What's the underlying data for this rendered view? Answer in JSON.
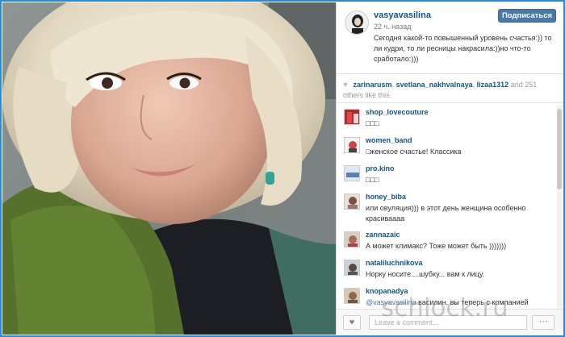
{
  "post": {
    "username": "vasyavasilina",
    "time": "22 ч. назад",
    "follow_label": "Подписаться",
    "caption": "Сегодня какой-то повышенный уровень счастья:)) то ли кудри, то ли ресницы накрасила:))но что-то сработало:)))"
  },
  "likes": {
    "names": [
      "zarinarusm",
      "svetlana_nakhvalnaya",
      "lizaa1312"
    ],
    "separator": ", ",
    "and_text": " and ",
    "count": "251",
    "suffix": "others like this."
  },
  "comments": [
    {
      "user": "shop_lovecouture",
      "text": "□□□"
    },
    {
      "user": "women_band",
      "text": "□женское счастье! Классика"
    },
    {
      "user": "pro.kino",
      "text": "□□□"
    },
    {
      "user": "honey_biba",
      "text": "или овуляция))) в этот день женщина особенно красиваааа"
    },
    {
      "user": "zannazaic",
      "text": "А может климакс? Тоже может быть )))))))"
    },
    {
      "user": "nataliluchnikova",
      "text": "Норку носите....шубку... вам к лицу."
    },
    {
      "user": "knopanadya",
      "mention": "@vasyavasilina",
      "text": " василин, вы теперь с компанией \"мастиф\" работает?"
    }
  ],
  "input": {
    "placeholder": "Leave a comment..."
  },
  "icons": {
    "like": "heart-icon",
    "more": "ellipsis-icon",
    "likes_heart": "heart-icon"
  },
  "watermark": "schlock.ru",
  "colors": {
    "link": "#125688",
    "button": "#4a79a8",
    "frame": "#2a8ad4"
  }
}
